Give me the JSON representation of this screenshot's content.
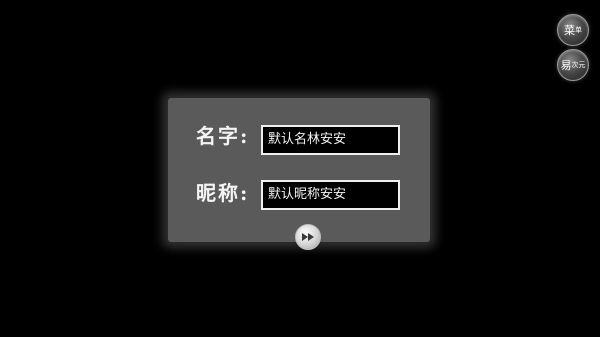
{
  "top_buttons": {
    "menu": {
      "main": "菜",
      "sub": "单"
    },
    "switch": {
      "main": "易",
      "sub": "次元"
    }
  },
  "form": {
    "name_label": "名字:",
    "name_value": "默认名林安安",
    "nickname_label": "昵称:",
    "nickname_value": "默认昵称安安"
  },
  "colors": {
    "background": "#000000",
    "panel": "#5a5a5a",
    "text": "#f4f4f4"
  },
  "icons": {
    "next": "fast-forward-icon"
  }
}
